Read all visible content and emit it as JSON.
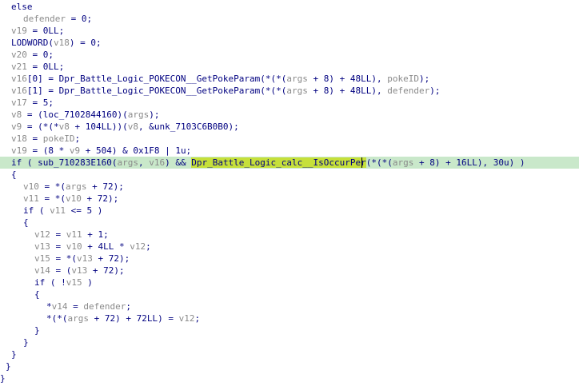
{
  "editor": {
    "highlighted_identifier": "Dpr_Battle_Logic_calc__IsOccurPer",
    "colors": {
      "background": "#ffffff",
      "text": "#000080",
      "variable": "#8a8a8a",
      "line_highlight": "#c9e8ca",
      "identifier_highlight": "#c6e03a"
    },
    "lines": [
      {
        "indent": 2,
        "tokens": [
          {
            "t": "else",
            "c": "p"
          }
        ]
      },
      {
        "indent": 4,
        "tokens": [
          {
            "t": "defender",
            "c": "v"
          },
          {
            "t": " = 0;",
            "c": "p"
          }
        ]
      },
      {
        "indent": 2,
        "tokens": [
          {
            "t": "v19",
            "c": "v"
          },
          {
            "t": " = 0LL;",
            "c": "p"
          }
        ]
      },
      {
        "indent": 2,
        "tokens": [
          {
            "t": "LODWORD(",
            "c": "p"
          },
          {
            "t": "v18",
            "c": "v"
          },
          {
            "t": ") = 0;",
            "c": "p"
          }
        ]
      },
      {
        "indent": 2,
        "tokens": [
          {
            "t": "v20",
            "c": "v"
          },
          {
            "t": " = 0;",
            "c": "p"
          }
        ]
      },
      {
        "indent": 2,
        "tokens": [
          {
            "t": "v21",
            "c": "v"
          },
          {
            "t": " = 0LL;",
            "c": "p"
          }
        ]
      },
      {
        "indent": 2,
        "tokens": [
          {
            "t": "v16",
            "c": "v"
          },
          {
            "t": "[0] = Dpr_Battle_Logic_POKECON__GetPokeParam(*(*(",
            "c": "p"
          },
          {
            "t": "args",
            "c": "v"
          },
          {
            "t": " + 8) + 48LL), ",
            "c": "p"
          },
          {
            "t": "pokeID",
            "c": "v"
          },
          {
            "t": ");",
            "c": "p"
          }
        ]
      },
      {
        "indent": 2,
        "tokens": [
          {
            "t": "v16",
            "c": "v"
          },
          {
            "t": "[1] = Dpr_Battle_Logic_POKECON__GetPokeParam(*(*(",
            "c": "p"
          },
          {
            "t": "args",
            "c": "v"
          },
          {
            "t": " + 8) + 48LL), ",
            "c": "p"
          },
          {
            "t": "defender",
            "c": "v"
          },
          {
            "t": ");",
            "c": "p"
          }
        ]
      },
      {
        "indent": 2,
        "tokens": [
          {
            "t": "v17",
            "c": "v"
          },
          {
            "t": " = 5;",
            "c": "p"
          }
        ]
      },
      {
        "indent": 2,
        "tokens": [
          {
            "t": "v8",
            "c": "v"
          },
          {
            "t": " = (loc_7102844160)(",
            "c": "p"
          },
          {
            "t": "args",
            "c": "v"
          },
          {
            "t": ");",
            "c": "p"
          }
        ]
      },
      {
        "indent": 2,
        "tokens": [
          {
            "t": "v9",
            "c": "v"
          },
          {
            "t": " = (*(*",
            "c": "p"
          },
          {
            "t": "v8",
            "c": "v"
          },
          {
            "t": " + 104LL))(",
            "c": "p"
          },
          {
            "t": "v8",
            "c": "v"
          },
          {
            "t": ", &unk_7103C6B0B0);",
            "c": "p"
          }
        ]
      },
      {
        "indent": 2,
        "tokens": [
          {
            "t": "v18",
            "c": "v"
          },
          {
            "t": " = ",
            "c": "p"
          },
          {
            "t": "pokeID",
            "c": "v"
          },
          {
            "t": ";",
            "c": "p"
          }
        ]
      },
      {
        "indent": 2,
        "tokens": [
          {
            "t": "v19",
            "c": "v"
          },
          {
            "t": " = (8 * ",
            "c": "p"
          },
          {
            "t": "v9",
            "c": "v"
          },
          {
            "t": " + 504) & 0x1F8 | 1u;",
            "c": "p"
          }
        ]
      },
      {
        "indent": 2,
        "highlight": true,
        "tokens": [
          {
            "t": "if ( sub_710283E160(",
            "c": "p"
          },
          {
            "t": "args",
            "c": "v"
          },
          {
            "t": ", ",
            "c": "p"
          },
          {
            "t": "v16",
            "c": "v"
          },
          {
            "t": ") && ",
            "c": "p"
          },
          {
            "t": "Dpr_Battle_Logic_calc__IsOccurPer",
            "c": "m"
          },
          {
            "t": "(*(*(",
            "c": "p"
          },
          {
            "t": "args",
            "c": "v"
          },
          {
            "t": " + 8) + 16LL), 30u) )",
            "c": "p"
          }
        ]
      },
      {
        "indent": 2,
        "tokens": [
          {
            "t": "{",
            "c": "p"
          }
        ]
      },
      {
        "indent": 4,
        "tokens": [
          {
            "t": "v10",
            "c": "v"
          },
          {
            "t": " = *(",
            "c": "p"
          },
          {
            "t": "args",
            "c": "v"
          },
          {
            "t": " + 72);",
            "c": "p"
          }
        ]
      },
      {
        "indent": 4,
        "tokens": [
          {
            "t": "v11",
            "c": "v"
          },
          {
            "t": " = *(",
            "c": "p"
          },
          {
            "t": "v10",
            "c": "v"
          },
          {
            "t": " + 72);",
            "c": "p"
          }
        ]
      },
      {
        "indent": 4,
        "tokens": [
          {
            "t": "if ( ",
            "c": "p"
          },
          {
            "t": "v11",
            "c": "v"
          },
          {
            "t": " <= 5 )",
            "c": "p"
          }
        ]
      },
      {
        "indent": 4,
        "tokens": [
          {
            "t": "{",
            "c": "p"
          }
        ]
      },
      {
        "indent": 6,
        "tokens": [
          {
            "t": "v12",
            "c": "v"
          },
          {
            "t": " = ",
            "c": "p"
          },
          {
            "t": "v11",
            "c": "v"
          },
          {
            "t": " + 1;",
            "c": "p"
          }
        ]
      },
      {
        "indent": 6,
        "tokens": [
          {
            "t": "v13",
            "c": "v"
          },
          {
            "t": " = ",
            "c": "p"
          },
          {
            "t": "v10",
            "c": "v"
          },
          {
            "t": " + 4LL * ",
            "c": "p"
          },
          {
            "t": "v12",
            "c": "v"
          },
          {
            "t": ";",
            "c": "p"
          }
        ]
      },
      {
        "indent": 6,
        "tokens": [
          {
            "t": "v15",
            "c": "v"
          },
          {
            "t": " = *(",
            "c": "p"
          },
          {
            "t": "v13",
            "c": "v"
          },
          {
            "t": " + 72);",
            "c": "p"
          }
        ]
      },
      {
        "indent": 6,
        "tokens": [
          {
            "t": "v14",
            "c": "v"
          },
          {
            "t": " = (",
            "c": "p"
          },
          {
            "t": "v13",
            "c": "v"
          },
          {
            "t": " + 72);",
            "c": "p"
          }
        ]
      },
      {
        "indent": 6,
        "tokens": [
          {
            "t": "if ( !",
            "c": "p"
          },
          {
            "t": "v15",
            "c": "v"
          },
          {
            "t": " )",
            "c": "p"
          }
        ]
      },
      {
        "indent": 6,
        "tokens": [
          {
            "t": "{",
            "c": "p"
          }
        ]
      },
      {
        "indent": 8,
        "tokens": [
          {
            "t": "*",
            "c": "p"
          },
          {
            "t": "v14",
            "c": "v"
          },
          {
            "t": " = ",
            "c": "p"
          },
          {
            "t": "defender",
            "c": "v"
          },
          {
            "t": ";",
            "c": "p"
          }
        ]
      },
      {
        "indent": 8,
        "tokens": [
          {
            "t": "*(*(",
            "c": "p"
          },
          {
            "t": "args",
            "c": "v"
          },
          {
            "t": " + 72) + 72LL) = ",
            "c": "p"
          },
          {
            "t": "v12",
            "c": "v"
          },
          {
            "t": ";",
            "c": "p"
          }
        ]
      },
      {
        "indent": 6,
        "tokens": [
          {
            "t": "}",
            "c": "p"
          }
        ]
      },
      {
        "indent": 4,
        "tokens": [
          {
            "t": "}",
            "c": "p"
          }
        ]
      },
      {
        "indent": 2,
        "tokens": [
          {
            "t": "}",
            "c": "p"
          }
        ]
      },
      {
        "indent": 1,
        "tokens": [
          {
            "t": "}",
            "c": "p"
          }
        ]
      },
      {
        "indent": 0,
        "tokens": [
          {
            "t": "}",
            "c": "p"
          }
        ]
      }
    ]
  }
}
